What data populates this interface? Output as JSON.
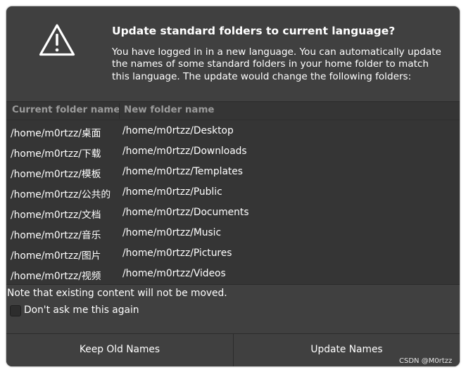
{
  "dialog": {
    "title": "Update standard folders to current language?",
    "message": "You have logged in in a new language. You can automatically update the names of some standard folders in your home folder to match this language. The update would change the following folders:",
    "icon": "warning-triangle-icon"
  },
  "table": {
    "headers": [
      "Current folder name",
      "New folder name"
    ],
    "rows": [
      {
        "current": "/home/m0rtzz/桌面",
        "new": "/home/m0rtzz/Desktop"
      },
      {
        "current": "/home/m0rtzz/下载",
        "new": "/home/m0rtzz/Downloads"
      },
      {
        "current": "/home/m0rtzz/模板",
        "new": "/home/m0rtzz/Templates"
      },
      {
        "current": "/home/m0rtzz/公共的",
        "new": "/home/m0rtzz/Public"
      },
      {
        "current": "/home/m0rtzz/文档",
        "new": "/home/m0rtzz/Documents"
      },
      {
        "current": "/home/m0rtzz/音乐",
        "new": "/home/m0rtzz/Music"
      },
      {
        "current": "/home/m0rtzz/图片",
        "new": "/home/m0rtzz/Pictures"
      },
      {
        "current": "/home/m0rtzz/视频",
        "new": "/home/m0rtzz/Videos"
      }
    ]
  },
  "note": "Note that existing content will not be moved.",
  "checkbox": {
    "label": "Don't ask me this again",
    "checked": false
  },
  "buttons": {
    "keep": "Keep Old Names",
    "update": "Update Names"
  },
  "watermark": "CSDN @M0rtzz",
  "colors": {
    "dialog_bg": "#404040",
    "table_bg": "#353535",
    "header_text": "#9a9a9a",
    "text": "#ffffff"
  }
}
